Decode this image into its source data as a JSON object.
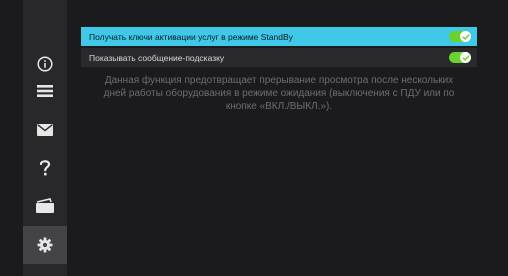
{
  "sidebar": {
    "items": [
      {
        "name": "info",
        "icon": "info-icon"
      },
      {
        "name": "list",
        "icon": "list-icon"
      },
      {
        "name": "messages",
        "icon": "envelope-icon"
      },
      {
        "name": "help",
        "icon": "question-icon"
      },
      {
        "name": "cards",
        "icon": "cards-icon"
      },
      {
        "name": "settings",
        "icon": "gear-icon",
        "active": true
      }
    ]
  },
  "settings": {
    "options": [
      {
        "label": "Получать ключи активации услуг в режиме StandBy",
        "enabled": true,
        "selected": true
      },
      {
        "label": "Показывать сообщение-подсказку",
        "enabled": true,
        "selected": false
      }
    ],
    "description": "Данная функция предотвращает прерывание просмотра после нескольких дней работы оборудования в режиме ожидания (выключения с ПДУ или по кнопке «ВКЛ./ВЫКЛ.»)."
  },
  "colors": {
    "accent": "#40c8e8",
    "toggle_on": "#69d22d",
    "background": "#1b1b1d",
    "sidebar": "#28282b"
  }
}
